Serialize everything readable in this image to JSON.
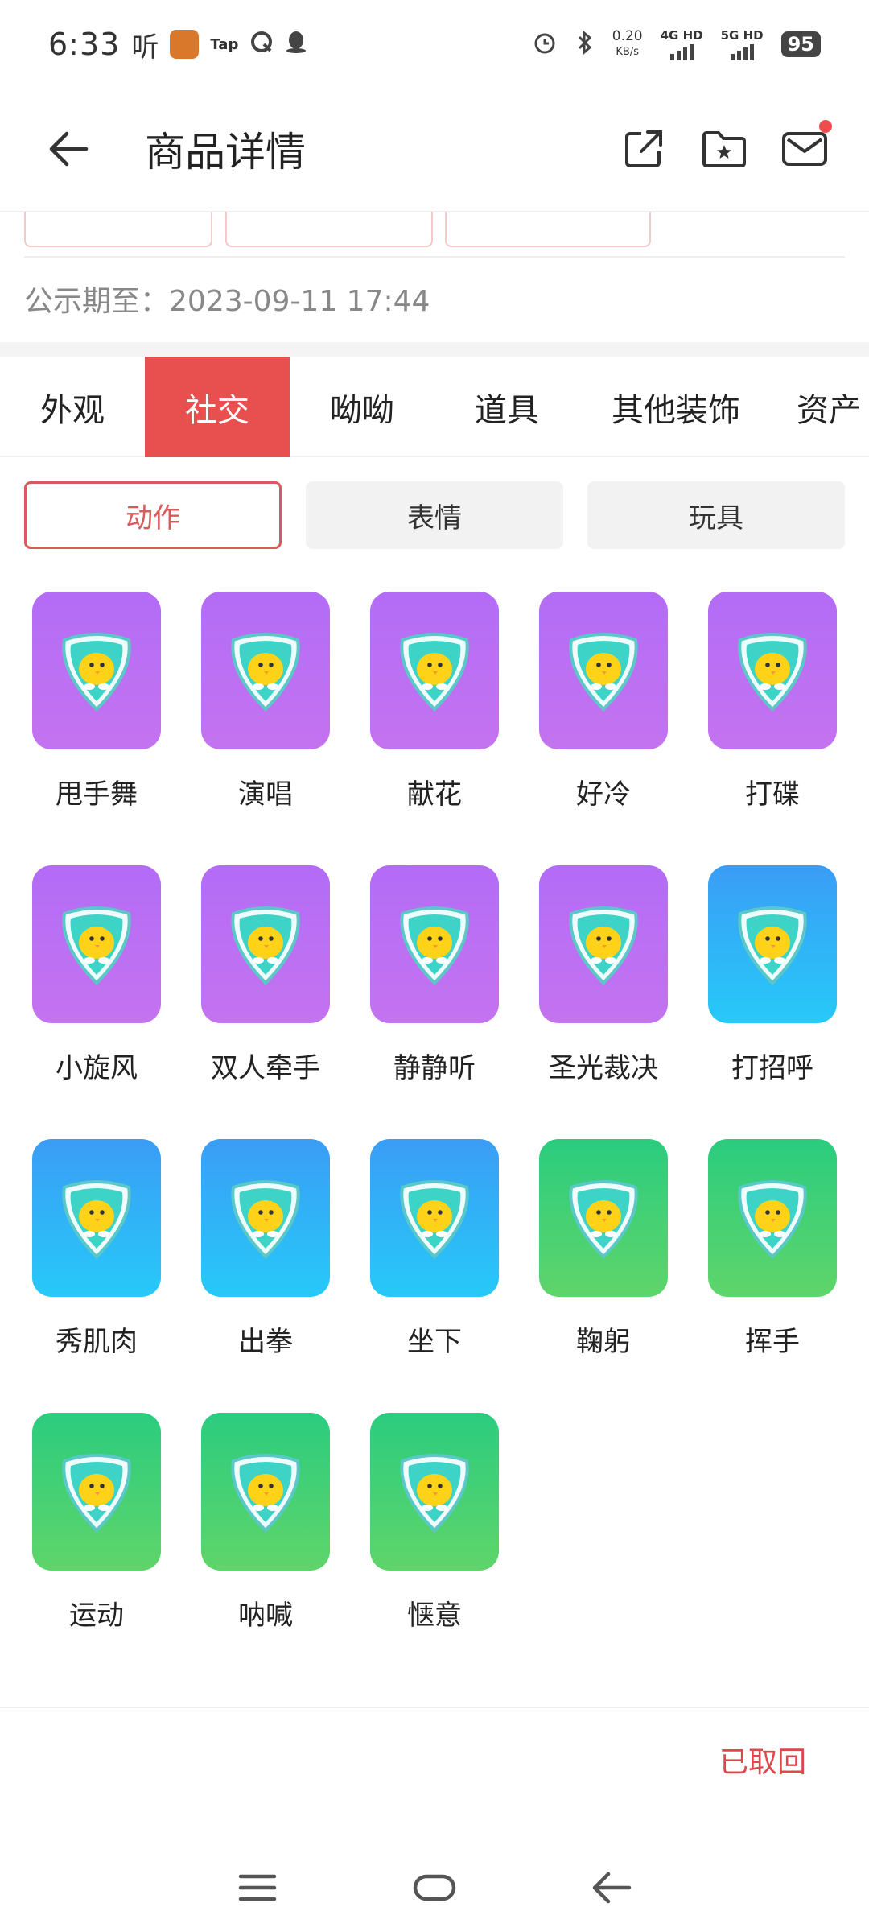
{
  "status_bar": {
    "time": "6:33",
    "listen_label": "听",
    "tap_label": "Tap",
    "net_speed": "0.20",
    "net_unit": "KB/s",
    "net1": "4G HD",
    "net2": "5G HD",
    "battery": "95"
  },
  "header": {
    "title": "商品详情"
  },
  "announce": {
    "label": "公示期至：",
    "value": "2023-09-11 17:44"
  },
  "tabs": [
    {
      "label": "外观",
      "active": false
    },
    {
      "label": "社交",
      "active": true
    },
    {
      "label": "呦呦",
      "active": false
    },
    {
      "label": "道具",
      "active": false
    },
    {
      "label": "其他装饰",
      "active": false
    },
    {
      "label": "资产",
      "active": false
    }
  ],
  "filters": [
    {
      "label": "动作",
      "active": true
    },
    {
      "label": "表情",
      "active": false
    },
    {
      "label": "玩具",
      "active": false
    }
  ],
  "items": [
    {
      "label": "甩手舞",
      "tone": "purple"
    },
    {
      "label": "演唱",
      "tone": "purple"
    },
    {
      "label": "献花",
      "tone": "purple"
    },
    {
      "label": "好冷",
      "tone": "purple"
    },
    {
      "label": "打碟",
      "tone": "purple"
    },
    {
      "label": "小旋风",
      "tone": "purple"
    },
    {
      "label": "双人牵手",
      "tone": "purple"
    },
    {
      "label": "静静听",
      "tone": "purple"
    },
    {
      "label": "圣光裁决",
      "tone": "purple"
    },
    {
      "label": "打招呼",
      "tone": "blue"
    },
    {
      "label": "秀肌肉",
      "tone": "blue"
    },
    {
      "label": "出拳",
      "tone": "blue"
    },
    {
      "label": "坐下",
      "tone": "blue"
    },
    {
      "label": "鞠躬",
      "tone": "green"
    },
    {
      "label": "挥手",
      "tone": "green"
    },
    {
      "label": "运动",
      "tone": "green"
    },
    {
      "label": "呐喊",
      "tone": "green"
    },
    {
      "label": "惬意",
      "tone": "green"
    }
  ],
  "bottom": {
    "status_text": "已取回"
  },
  "colors": {
    "accent": "#e84f4f",
    "purple_tile": "#b36cf7",
    "blue_tile": "#3a9df6",
    "green_tile": "#2bcc7f"
  }
}
